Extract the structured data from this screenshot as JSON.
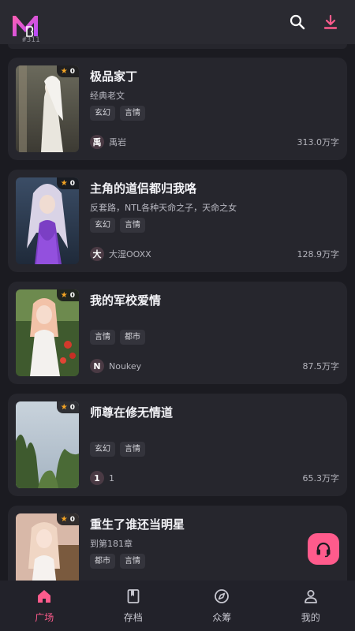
{
  "colors": {
    "accent": "#ff5b8c",
    "background": "#1b1b21",
    "card": "#26262d",
    "star": "#f5a524"
  },
  "header": {
    "logo_icon": "app-logo-icon",
    "logo_caption": "#311",
    "actions": [
      {
        "icon": "search-icon"
      },
      {
        "icon": "download-icon"
      }
    ]
  },
  "books": [
    {
      "title": "极品家丁",
      "desc": "经典老文",
      "tags": [
        "玄幻",
        "言情"
      ],
      "rating": "0",
      "author_initial": "禹",
      "author": "禹岩",
      "words": "313.0万字"
    },
    {
      "title": "主角的道侣都归我咯",
      "desc": "反套路，NTL各种天命之子，天命之女",
      "tags": [
        "玄幻",
        "言情"
      ],
      "rating": "0",
      "author_initial": "大",
      "author": "大湿OOXX",
      "words": "128.9万字"
    },
    {
      "title": "我的军校爱情",
      "desc": "",
      "tags": [
        "言情",
        "都市"
      ],
      "rating": "0",
      "author_initial": "N",
      "author": "Noukey",
      "words": "87.5万字"
    },
    {
      "title": "师尊在修无情道",
      "desc": "",
      "tags": [
        "玄幻",
        "言情"
      ],
      "rating": "0",
      "author_initial": "1",
      "author": "1",
      "words": "65.3万字"
    },
    {
      "title": "重生了谁还当明星",
      "desc": "到第181章",
      "tags": [
        "都市",
        "言情"
      ],
      "rating": "0",
      "author_initial": "",
      "author": "",
      "words": ""
    }
  ],
  "fab": {
    "icon": "headset-icon"
  },
  "nav": [
    {
      "label": "广场",
      "icon": "home-icon",
      "active": true
    },
    {
      "label": "存档",
      "icon": "book-icon",
      "active": false
    },
    {
      "label": "众筹",
      "icon": "compass-icon",
      "active": false
    },
    {
      "label": "我的",
      "icon": "user-icon",
      "active": false
    }
  ]
}
